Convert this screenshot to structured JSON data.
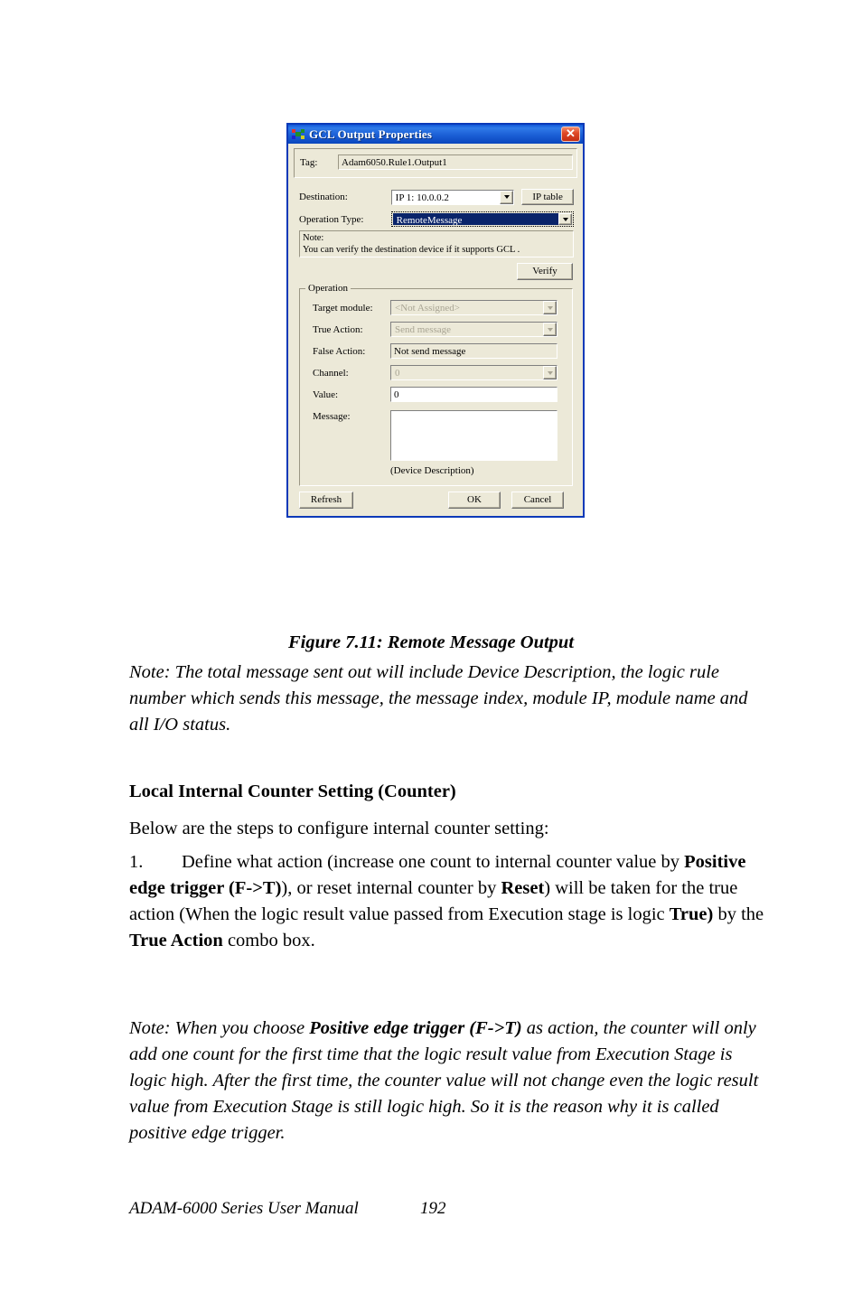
{
  "dialog": {
    "title": "GCL Output Properties",
    "icon": "app-pixel-icon",
    "close_label": "✕",
    "tag": {
      "label": "Tag:",
      "value": "Adam6050.Rule1.Output1"
    },
    "destination": {
      "label": "Destination:",
      "value": "IP  1: 10.0.0.2",
      "ip_table_button": "IP table"
    },
    "operation_type": {
      "label": "Operation Type:",
      "value": "RemoteMessage",
      "selected": true
    },
    "note": {
      "line1": "Note:",
      "line2": "You can verify the destination device if it supports GCL ."
    },
    "verify_button": "Verify",
    "operation_group": {
      "legend": "Operation",
      "target_module": {
        "label": "Target module:",
        "value": "<Not Assigned>",
        "disabled": true
      },
      "true_action": {
        "label": "True Action:",
        "value": "Send message",
        "disabled": true
      },
      "false_action": {
        "label": "False Action:",
        "value": "Not send message"
      },
      "channel": {
        "label": "Channel:",
        "value": "0",
        "disabled": true
      },
      "value_field": {
        "label": "Value:",
        "value": "0"
      },
      "message": {
        "label": "Message:",
        "value": "",
        "caption": "(Device Description)"
      }
    },
    "buttons": {
      "refresh": "Refresh",
      "ok": "OK",
      "cancel": "Cancel"
    },
    "colors": {
      "titlebar": "#1157d8",
      "face": "#ece9d8",
      "selection": "#0a246a",
      "close": "#c42d12",
      "frame": "#0a39b8"
    }
  },
  "document": {
    "figure_caption": "Figure 7.11: Remote Message Output",
    "note_after_figure": "Note: The total message sent out will include Device Description, the logic rule number which sends this message, the message index, module IP, module name and all I/O status.",
    "heading": "Local Internal Counter Setting (Counter)",
    "intro": "Below are the steps to configure internal counter setting:",
    "list": {
      "number": "1.",
      "part1": "Define what action (increase one count to internal counter value by ",
      "bold1": "Positive edge trigger (F->T)",
      "part2": "), or reset internal counter by ",
      "bold2": "Reset",
      "part3": ") will be taken for the true action (When the logic result value passed from Execution stage is logic ",
      "bold3": "True)",
      "part4": " by the ",
      "bold4": "True Action",
      "part5": " combo box."
    },
    "note_2": {
      "part1": "Note: When you choose ",
      "bold1": "Positive edge trigger (F->T)",
      "part2": " as action, the counter will only add one count for the first time that the logic result value from Execution Stage is logic high. After the first time, the counter value will not change even the logic result value from Execution Stage is still logic high. So it is the reason why it is called positive edge trigger."
    },
    "footer": {
      "manual": "ADAM-6000 Series User Manual",
      "page": "192"
    }
  }
}
